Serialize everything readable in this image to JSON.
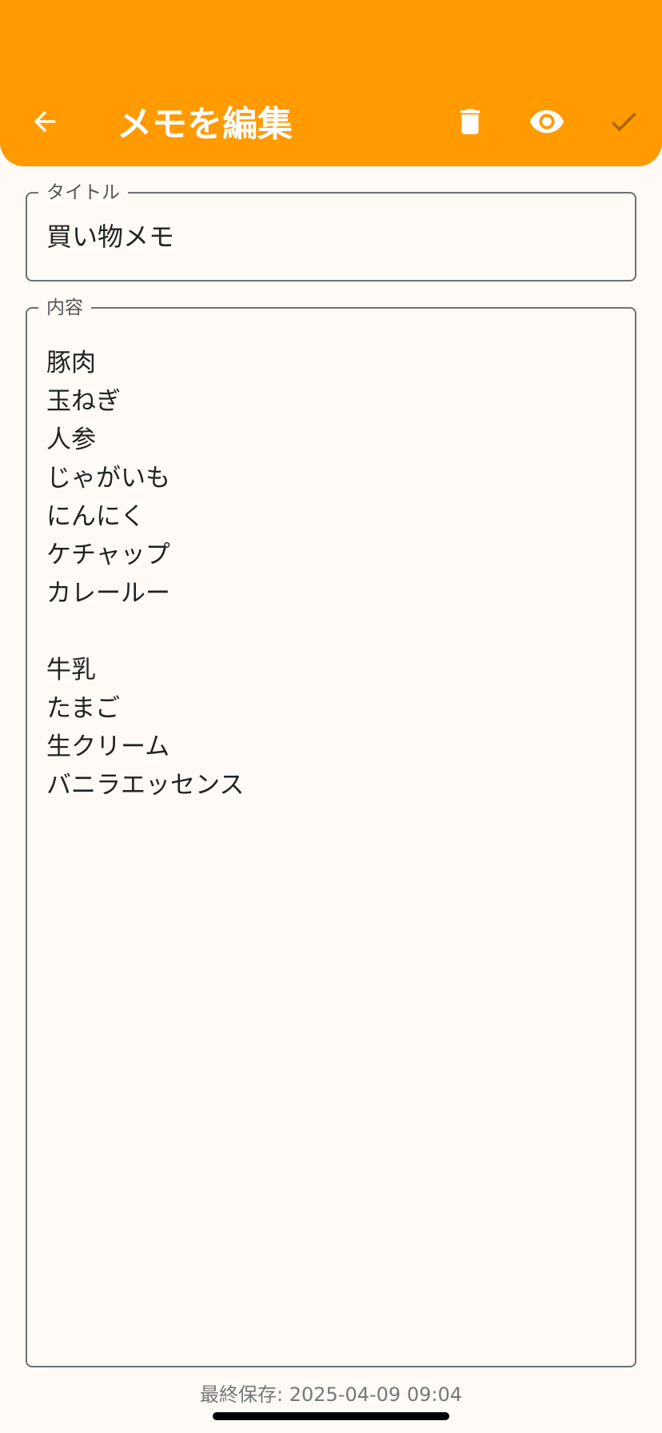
{
  "app_bar": {
    "title": "メモを編集",
    "background_color": "#ff9a00",
    "actions": [
      {
        "name": "back",
        "icon": "arrow-back-icon"
      },
      {
        "name": "delete",
        "icon": "trash-icon"
      },
      {
        "name": "preview",
        "icon": "eye-icon"
      },
      {
        "name": "save",
        "icon": "check-icon"
      }
    ]
  },
  "title_field": {
    "label": "タイトル",
    "value": "買い物メモ"
  },
  "content_field": {
    "label": "内容",
    "lines": [
      "豚肉",
      "玉ねぎ",
      "人参",
      "じゃがいも",
      "にんにく",
      "ケチャップ",
      "カレールー",
      "",
      "牛乳",
      "たまご",
      "生クリーム",
      "バニラエッセンス"
    ]
  },
  "footer": {
    "last_saved": "最終保存: 2025-04-09 09:04"
  }
}
